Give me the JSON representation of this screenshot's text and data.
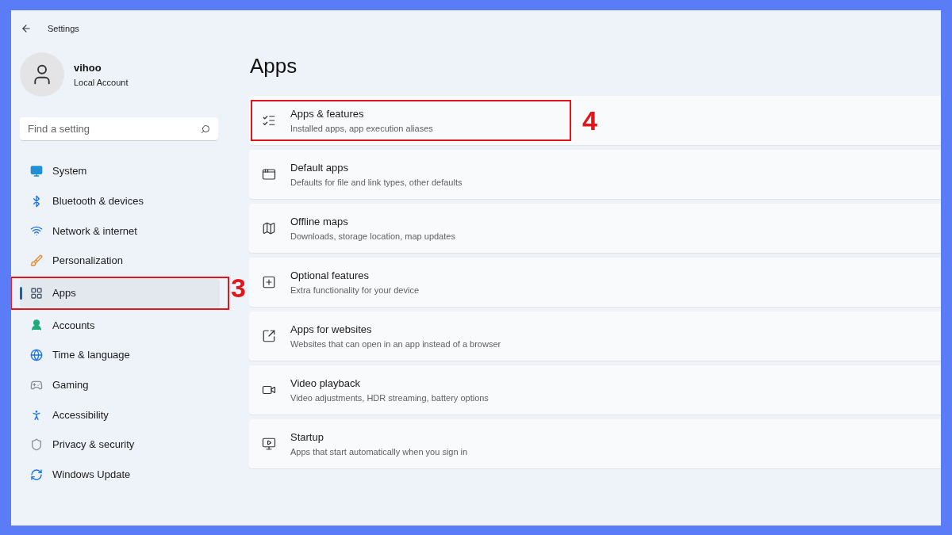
{
  "window": {
    "title": "Settings"
  },
  "account": {
    "name": "vihoo",
    "type": "Local Account"
  },
  "search": {
    "placeholder": "Find a setting"
  },
  "nav": [
    {
      "label": "System",
      "kind": "system",
      "selected": false
    },
    {
      "label": "Bluetooth & devices",
      "kind": "bluetooth",
      "selected": false
    },
    {
      "label": "Network & internet",
      "kind": "network",
      "selected": false
    },
    {
      "label": "Personalization",
      "kind": "personalization",
      "selected": false
    },
    {
      "label": "Apps",
      "kind": "apps",
      "selected": true,
      "callout": "3"
    },
    {
      "label": "Accounts",
      "kind": "accounts",
      "selected": false
    },
    {
      "label": "Time & language",
      "kind": "time",
      "selected": false
    },
    {
      "label": "Gaming",
      "kind": "gaming",
      "selected": false
    },
    {
      "label": "Accessibility",
      "kind": "accessibility",
      "selected": false
    },
    {
      "label": "Privacy & security",
      "kind": "privacy",
      "selected": false
    },
    {
      "label": "Windows Update",
      "kind": "update",
      "selected": false
    }
  ],
  "page_title": "Apps",
  "cards": [
    {
      "title": "Apps & features",
      "subtitle": "Installed apps, app execution aliases",
      "kind": "list",
      "callout": "4"
    },
    {
      "title": "Default apps",
      "subtitle": "Defaults for file and link types, other defaults",
      "kind": "default"
    },
    {
      "title": "Offline maps",
      "subtitle": "Downloads, storage location, map updates",
      "kind": "map"
    },
    {
      "title": "Optional features",
      "subtitle": "Extra functionality for your device",
      "kind": "optional"
    },
    {
      "title": "Apps for websites",
      "subtitle": "Websites that can open in an app instead of a browser",
      "kind": "websites"
    },
    {
      "title": "Video playback",
      "subtitle": "Video adjustments, HDR streaming, battery options",
      "kind": "video"
    },
    {
      "title": "Startup",
      "subtitle": "Apps that start automatically when you sign in",
      "kind": "startup"
    }
  ]
}
